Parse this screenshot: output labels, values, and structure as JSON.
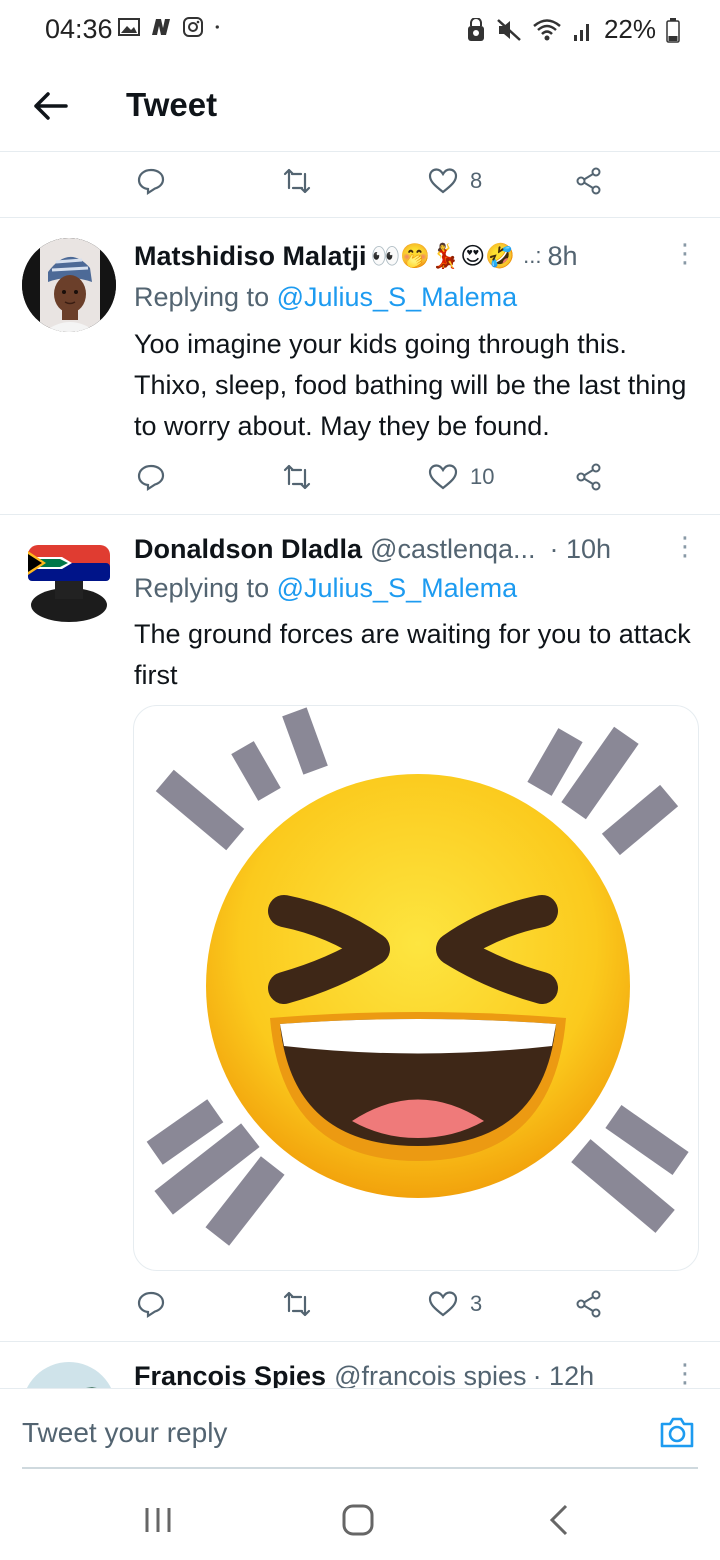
{
  "status_bar": {
    "time": "04:36",
    "battery": "22%"
  },
  "header": {
    "title": "Tweet"
  },
  "top_actions": {
    "like_count": "8"
  },
  "tweets": [
    {
      "name": "Matshidiso Malatji",
      "name_emojis": "👀🤭💃😍🤣",
      "handle": "..:",
      "time": "8h",
      "replying_label": "Replying to",
      "replying_to": "@Julius_S_Malema",
      "body": "Yoo imagine your kids going through this. Thixo, sleep, food bathing will be the last thing to worry about. May they be found.",
      "like_count": "10"
    },
    {
      "name": "Donaldson Dladla",
      "handle": "@castlenqa...",
      "time": "· 10h",
      "replying_label": "Replying to",
      "replying_to": "@Julius_S_Malema",
      "body": "The ground forces are waiting for you to attack first",
      "like_count": "3"
    },
    {
      "name": "Francois Spies",
      "handle": "@francois spies",
      "time": "· 12h"
    }
  ],
  "reply_box": {
    "placeholder": "Tweet your reply"
  },
  "colors": {
    "accent": "#1d9bf0",
    "secondary_text": "#536471",
    "divider": "#e6ecf0"
  }
}
